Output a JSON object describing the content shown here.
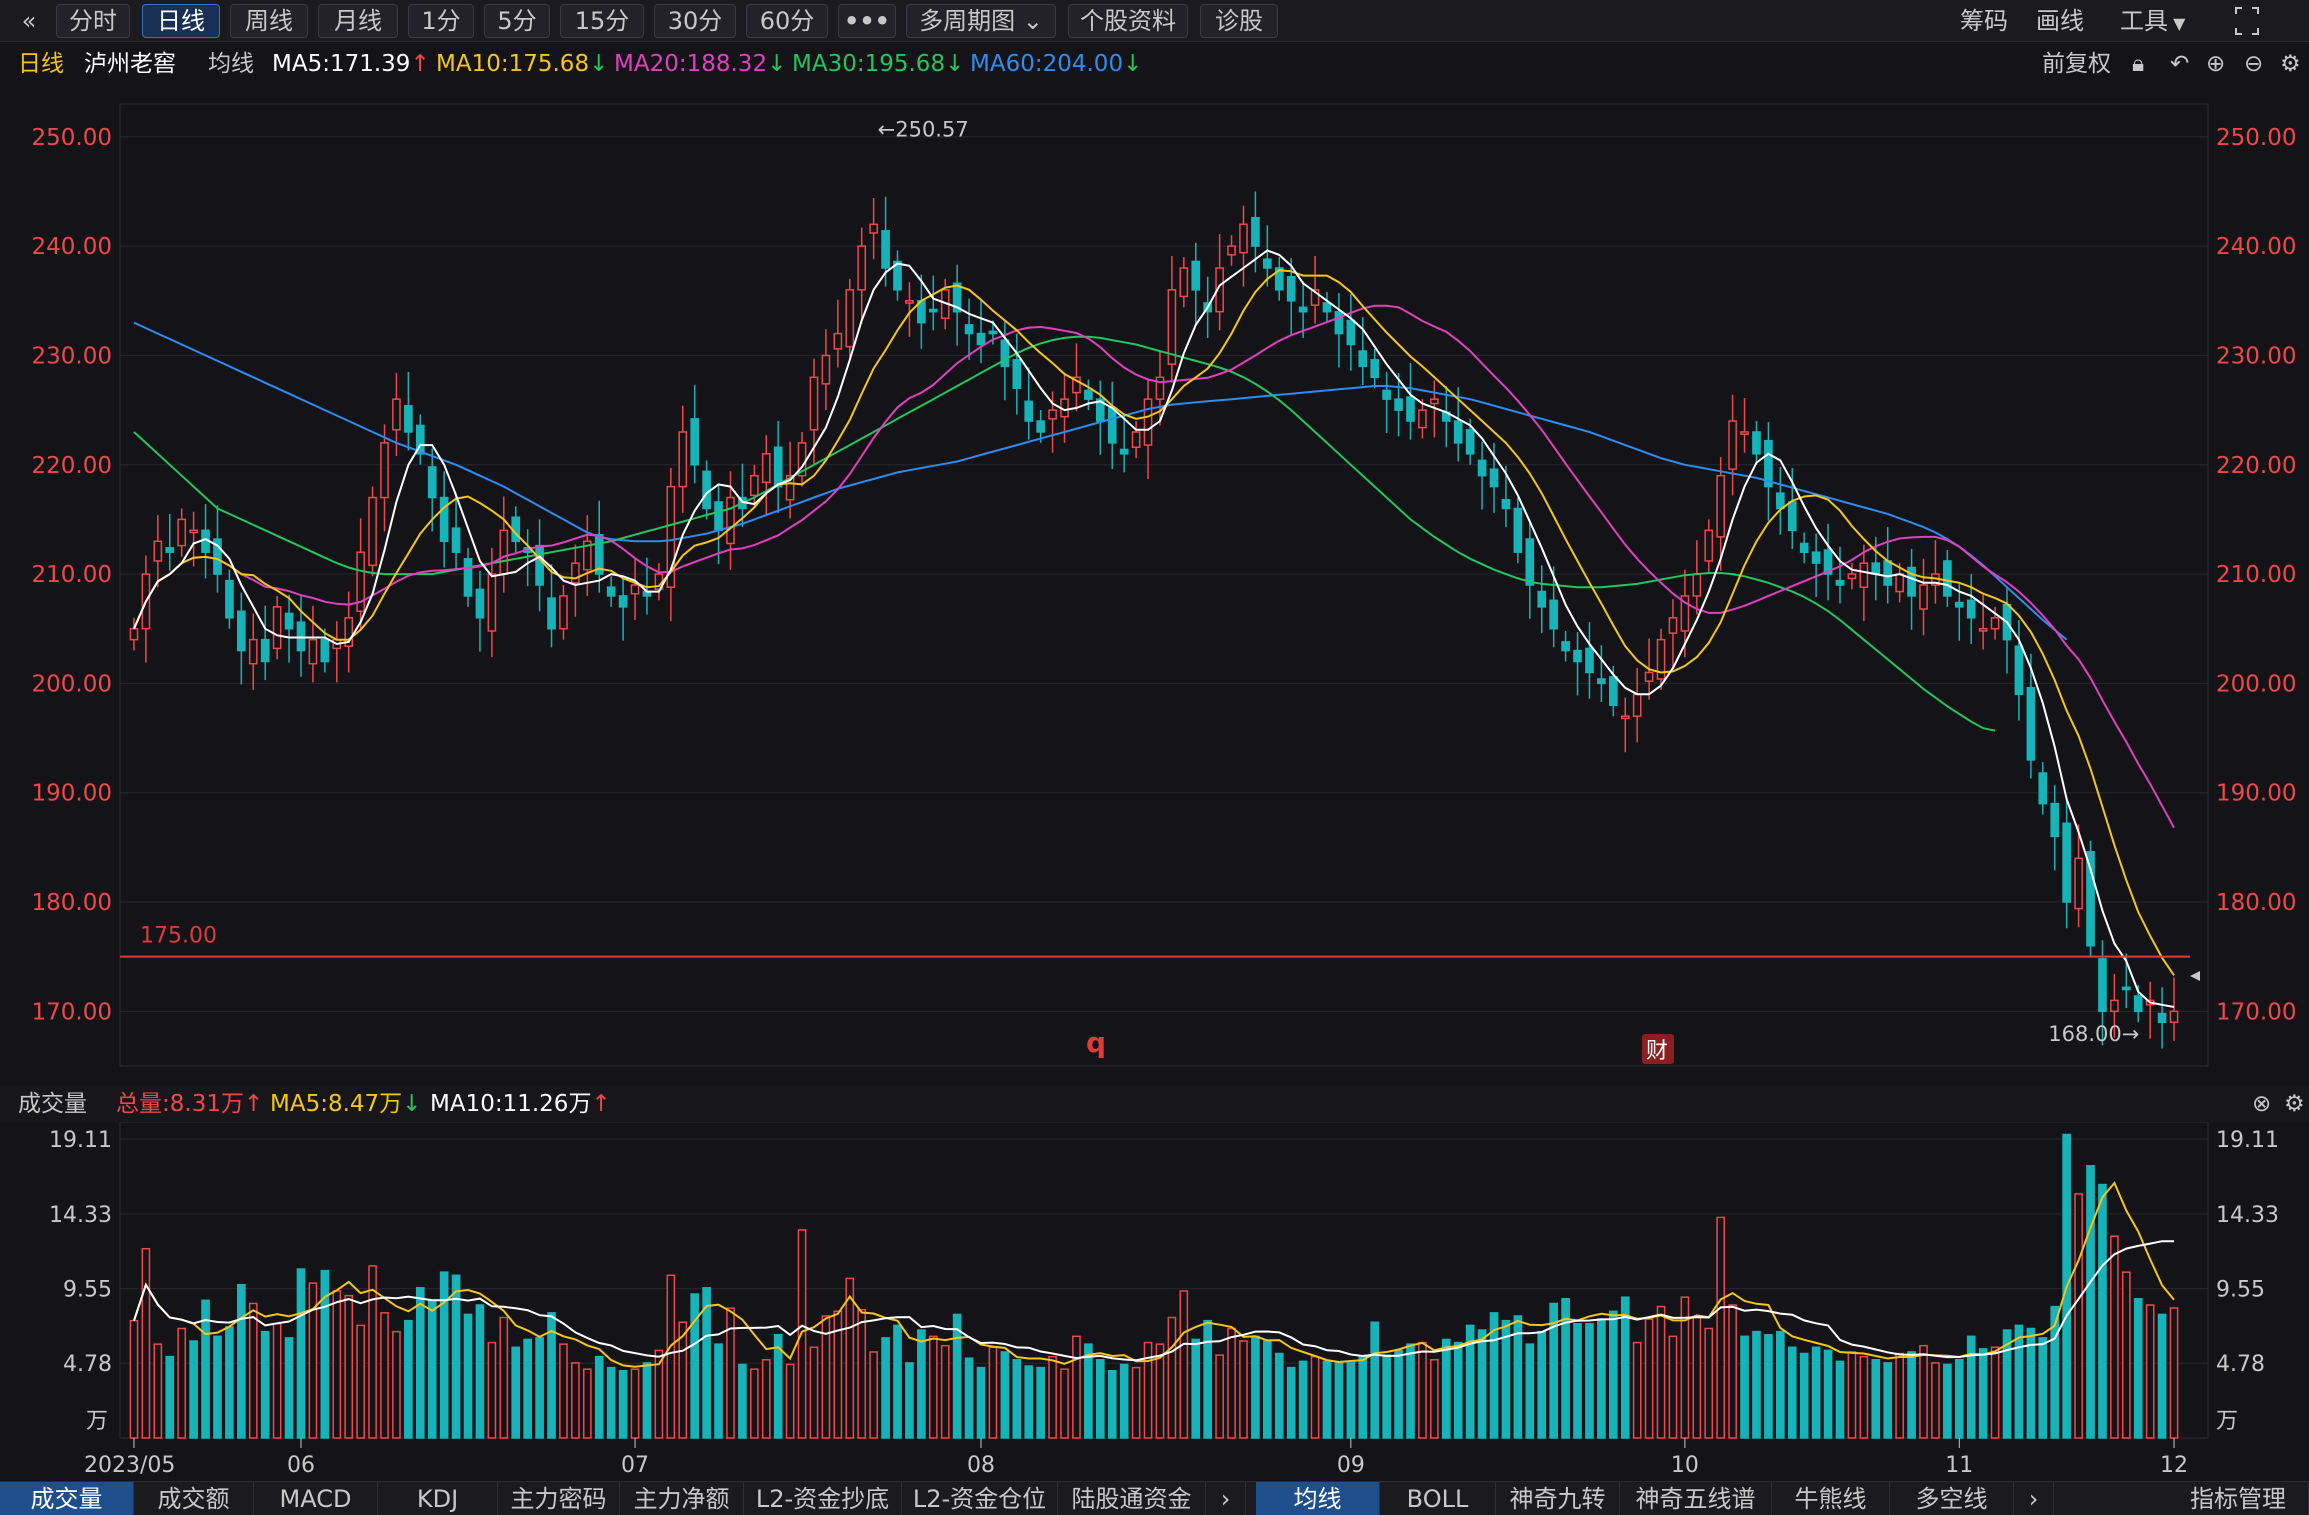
{
  "toolbar": {
    "collapse_icon": "double-chevron-left-icon",
    "periods": [
      "分时",
      "日线",
      "周线",
      "月线",
      "1分",
      "5分",
      "15分",
      "30分",
      "60分"
    ],
    "active_period": "日线",
    "more_label": "•••",
    "multi_period": "多周期图",
    "stock_info": "个股资料",
    "diagnose": "诊股",
    "right": {
      "chips": "筹码",
      "draw": "画线",
      "tools": "工具"
    },
    "fullscreen_icon": "fullscreen-icon"
  },
  "legend": {
    "period": "日线",
    "stock_name": "泸州老窖",
    "ma_label": "均线",
    "ma5": "MA5:171.39",
    "ma10": "MA10:175.68",
    "ma20": "MA20:188.32",
    "ma30": "MA30:195.68",
    "ma60": "MA60:204.00",
    "adjust": "前复权",
    "colors": {
      "ma5": "#ffffff",
      "ma10": "#f5c518",
      "ma20": "#e040c0",
      "ma30": "#22c55e",
      "ma60": "#2d8cf0",
      "up": "#f04848",
      "down": "#16b3b8"
    }
  },
  "price_panel": {
    "y_ticks": [
      "250.00",
      "240.00",
      "230.00",
      "220.00",
      "210.00",
      "200.00",
      "190.00",
      "180.00",
      "170.00"
    ],
    "alert_line_label": "175.00",
    "high_label": "←250.57",
    "low_label": "168.00→",
    "marker_q": "q",
    "marker_fin": "财"
  },
  "volume_header": {
    "title": "成交量",
    "total": "总量:8.31万",
    "ma5": "MA5:8.47万",
    "ma10": "MA10:11.26万"
  },
  "volume_panel": {
    "y_ticks": [
      "19.11",
      "14.33",
      "9.55",
      "4.78"
    ],
    "unit": "万"
  },
  "x_axis": {
    "labels": [
      "2023/05",
      "06",
      "07",
      "08",
      "09",
      "10",
      "11",
      "12"
    ]
  },
  "bottom_tabs": {
    "left": [
      "成交量",
      "成交额",
      "MACD",
      "KDJ",
      "主力密码",
      "主力净额",
      "L2-资金抄底",
      "L2-资金仓位",
      "陆股通资金"
    ],
    "right": [
      "均线",
      "BOLL",
      "神奇九转",
      "神奇五线谱",
      "牛熊线",
      "多空线"
    ],
    "manage": "指标管理"
  },
  "chart_data": {
    "type": "candlestick",
    "title": "泸州老窖 日线",
    "x_labels": [
      "2023/05",
      "06",
      "07",
      "08",
      "09",
      "10",
      "11",
      "12"
    ],
    "ylim": [
      165,
      253
    ],
    "moving_averages": {
      "MA5": 171.39,
      "MA10": 175.68,
      "MA20": 188.32,
      "MA30": 195.68,
      "MA60": 204.0
    },
    "period_high": 250.57,
    "period_low": 168.0,
    "alert_line": 175.0,
    "closes": [
      205,
      210,
      213,
      212,
      215,
      214,
      212,
      210,
      206,
      203,
      204,
      202,
      207,
      205,
      203,
      204,
      202,
      204,
      206,
      212,
      217,
      222,
      226,
      223,
      221,
      217,
      213,
      212,
      208,
      206,
      210,
      214,
      213,
      212,
      209,
      205,
      208,
      211,
      213,
      210,
      208,
      207,
      209,
      208,
      210,
      218,
      223,
      220,
      216,
      214,
      217,
      216,
      219,
      221,
      218,
      219,
      222,
      228,
      230,
      232,
      236,
      240,
      242,
      238,
      236,
      235,
      233,
      234,
      236,
      234,
      232,
      231,
      232,
      229,
      227,
      224,
      223,
      225,
      226,
      228,
      226,
      224,
      222,
      221,
      223,
      226,
      228,
      236,
      238,
      236,
      234,
      238,
      240,
      242,
      240,
      238,
      236,
      235,
      234,
      236,
      234,
      232,
      231,
      229,
      228,
      226,
      225,
      224,
      225,
      226,
      224,
      222,
      221,
      219,
      218,
      216,
      212,
      209,
      207,
      205,
      203,
      202,
      201,
      200,
      198,
      197,
      199,
      201,
      204,
      206,
      208,
      210,
      214,
      219,
      224,
      223,
      221,
      218,
      216,
      214,
      212,
      211,
      210,
      209,
      210,
      211,
      210,
      209,
      210,
      208,
      209,
      210,
      208,
      207,
      206,
      205,
      206,
      204,
      199,
      193,
      189,
      186,
      180,
      184,
      176,
      170,
      171,
      172,
      170,
      171,
      169,
      170
    ],
    "volumes": [
      7.5,
      12.1,
      6.0,
      5.2,
      7.0,
      6.2,
      8.8,
      6.5,
      7.1,
      9.8,
      8.6,
      6.8,
      7.3,
      6.4,
      10.8,
      9.9,
      10.7,
      9.4,
      9.1,
      7.2,
      11.0,
      8.0,
      6.8,
      7.5,
      9.6,
      8.8,
      10.6,
      10.4,
      7.9,
      8.5,
      6.1,
      7.7,
      5.8,
      6.3,
      6.4,
      8.0,
      6.0,
      4.8,
      4.4,
      5.2,
      4.5,
      4.3,
      4.4,
      4.8,
      5.6,
      10.4,
      7.4,
      9.2,
      9.6,
      6.0,
      8.3,
      4.7,
      4.4,
      5.0,
      6.6,
      4.7,
      13.3,
      5.8,
      7.8,
      8.1,
      10.2,
      8.2,
      5.5,
      6.4,
      7.2,
      4.8,
      6.9,
      6.5,
      5.9,
      7.9,
      5.1,
      4.5,
      5.8,
      5.5,
      5.0,
      4.6,
      4.5,
      5.2,
      4.4,
      6.5,
      6.0,
      5.0,
      4.3,
      4.7,
      4.5,
      6.1,
      6.0,
      7.7,
      9.4,
      6.3,
      7.5,
      5.3,
      7.0,
      6.2,
      6.5,
      6.2,
      5.4,
      4.5,
      4.9,
      5.2,
      4.9,
      4.8,
      4.8,
      5.2,
      7.4,
      5.3,
      5.6,
      6.0,
      6.1,
      5.0,
      6.3,
      6.1,
      7.2,
      6.9,
      8.0,
      7.5,
      7.8,
      6.0,
      6.8,
      8.6,
      8.9,
      7.3,
      7.3,
      7.6,
      8.1,
      9.0,
      6.1,
      7.6,
      8.4,
      6.5,
      9.0,
      7.7,
      7.0,
      14.1,
      8.5,
      6.5,
      6.8,
      6.6,
      6.8,
      5.8,
      5.4,
      5.8,
      5.6,
      4.9,
      5.5,
      5.2,
      5.0,
      4.8,
      5.4,
      5.5,
      5.9,
      4.8,
      4.7,
      5.0,
      6.5,
      5.7,
      5.8,
      6.9,
      7.2,
      7.0,
      6.4,
      8.4,
      19.4,
      15.6,
      17.4,
      16.2,
      12.9,
      10.6,
      8.9,
      8.5,
      7.9,
      8.31
    ],
    "ma60_points": [
      233,
      232.5,
      232,
      231.5,
      231,
      230.5,
      230,
      229.5,
      229,
      228.5,
      228,
      227.5,
      227,
      226.5,
      226,
      225.5,
      225,
      224.5,
      224,
      223.5,
      223,
      222.5,
      222,
      221.6,
      221.2,
      220.8,
      220.4,
      220,
      219.5,
      219,
      218.5,
      218,
      217.4,
      216.8,
      216.2,
      215.6,
      215,
      214.4,
      213.8,
      213.4,
      213.2,
      213.1,
      213,
      213,
      213,
      213.1,
      213.3,
      213.5,
      213.7,
      214,
      214.3,
      214.6,
      215,
      215.4,
      215.8,
      216.2,
      216.6,
      217,
      217.4,
      217.8,
      218.1,
      218.4,
      218.7,
      219,
      219.3,
      219.5,
      219.7,
      219.9,
      220.1,
      220.3,
      220.6,
      220.9,
      221.2,
      221.5,
      221.8,
      222.1,
      222.4,
      222.7,
      223,
      223.3,
      223.6,
      223.9,
      224.2,
      224.5,
      224.8,
      225.1,
      225.3,
      225.5,
      225.6,
      225.7,
      225.8,
      225.9,
      226,
      226.1,
      226.2,
      226.3,
      226.4,
      226.5,
      226.6,
      226.7,
      226.8,
      226.9,
      227,
      227.1,
      227.2,
      227.2,
      227.1,
      227,
      226.8,
      226.6,
      226.4,
      226.2,
      226,
      225.7,
      225.4,
      225.1,
      224.8,
      224.5,
      224.2,
      223.9,
      223.6,
      223.3,
      223,
      222.6,
      222.2,
      221.8,
      221.4,
      221,
      220.6,
      220.3,
      220,
      219.8,
      219.6,
      219.4,
      219.2,
      219,
      218.8,
      218.5,
      218.2,
      217.9,
      217.6,
      217.3,
      217,
      216.7,
      216.4,
      216.1,
      215.8,
      215.5,
      215.1,
      214.7,
      214.3,
      213.8,
      213.2,
      212.5,
      211.7,
      210.8,
      209.8,
      208.8,
      207.8,
      206.8,
      205.8,
      204.9,
      204.0
    ],
    "ma30_points": [
      223,
      222,
      221,
      220,
      219,
      218,
      217,
      216,
      215.5,
      215,
      214.5,
      214,
      213.5,
      213,
      212.5,
      212,
      211.5,
      211,
      210.6,
      210.3,
      210.1,
      210,
      210,
      210,
      210,
      210,
      210.2,
      210.4,
      210.6,
      210.8,
      211,
      211.2,
      211.4,
      211.6,
      211.8,
      212,
      212.2,
      212.4,
      212.6,
      212.8,
      213,
      213.3,
      213.6,
      213.9,
      214.2,
      214.5,
      214.8,
      215.1,
      215.4,
      215.7,
      216,
      216.5,
      217,
      217.6,
      218.2,
      218.8,
      219.4,
      220,
      220.6,
      221.2,
      221.8,
      222.4,
      223,
      223.6,
      224.2,
      224.8,
      225.4,
      226,
      226.6,
      227.2,
      227.8,
      228.4,
      229,
      229.6,
      230.2,
      230.7,
      231.1,
      231.4,
      231.6,
      231.7,
      231.7,
      231.6,
      231.4,
      231.2,
      231,
      230.7,
      230.4,
      230.1,
      229.8,
      229.5,
      229.2,
      228.9,
      228.5,
      228,
      227.4,
      226.7,
      225.9,
      225,
      224,
      223,
      222,
      221,
      220,
      219,
      218,
      217,
      216,
      215,
      214.2,
      213.4,
      212.7,
      212,
      211.4,
      210.9,
      210.4,
      210,
      209.6,
      209.3,
      209.1,
      209,
      208.9,
      208.8,
      208.8,
      208.8,
      208.9,
      209,
      209.1,
      209.3,
      209.5,
      209.7,
      209.9,
      210,
      210.1,
      210.1,
      210,
      209.8,
      209.5,
      209.2,
      208.8,
      208.4,
      207.9,
      207.3,
      206.6,
      205.8,
      204.9,
      204,
      203.1,
      202.2,
      201.3,
      200.4,
      199.5,
      198.7,
      197.9,
      197.2,
      196.5,
      195.9,
      195.68
    ],
    "series": [
      {
        "name": "MA5",
        "last": 171.39
      },
      {
        "name": "MA10",
        "last": 175.68
      },
      {
        "name": "MA20",
        "last": 188.32
      },
      {
        "name": "MA30",
        "last": 195.68
      },
      {
        "name": "MA60",
        "last": 204.0
      }
    ]
  }
}
